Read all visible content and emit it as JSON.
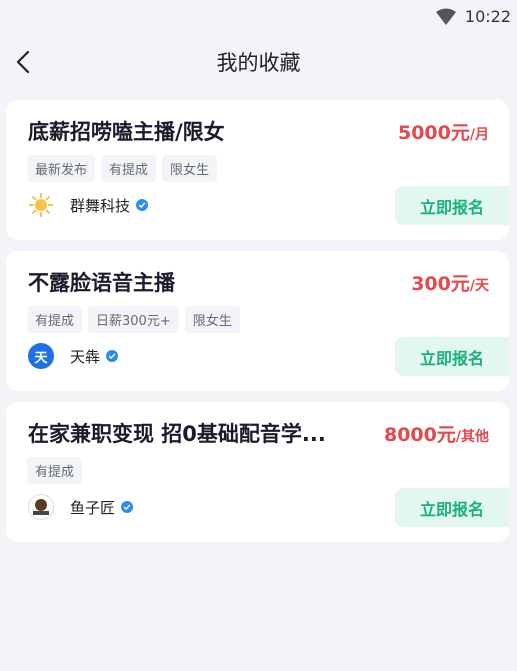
{
  "status": {
    "time": "10:22"
  },
  "header": {
    "title": "我的收藏"
  },
  "jobs": [
    {
      "title": "底薪招唠嗑主播/限女",
      "salary_amount": "5000元",
      "salary_unit": "/月",
      "tags": [
        "最新发布",
        "有提成",
        "限女生"
      ],
      "company": "群舞科技",
      "logo": "sun",
      "apply_label": "立即报名"
    },
    {
      "title": "不露脸语音主播",
      "salary_amount": "300元",
      "salary_unit": "/天",
      "tags": [
        "有提成",
        "日薪300元+",
        "限女生"
      ],
      "company": "天犇",
      "logo_text": "天",
      "apply_label": "立即报名"
    },
    {
      "title": "在家兼职变现 招0基础配音学...",
      "salary_amount": "8000元",
      "salary_unit": "/其他",
      "tags": [
        "有提成"
      ],
      "company": "鱼子匠",
      "logo": "yu",
      "apply_label": "立即报名"
    }
  ],
  "colors": {
    "accent": "#e5484d",
    "apply_bg": "#e1f7ef",
    "apply_text": "#19b17a",
    "verified": "#2d8cf0"
  }
}
